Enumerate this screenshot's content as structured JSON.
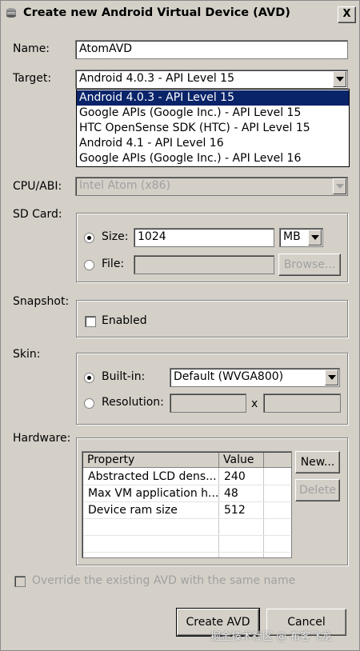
{
  "window": {
    "title": "Create new Android Virtual Device (AVD)",
    "close_label": "X"
  },
  "form": {
    "name_label": "Name:",
    "name_value": "AtomAVD",
    "target_label": "Target:",
    "target_value": "Android 4.0.3 - API Level 15",
    "target_options": [
      "Android 4.0.3 - API Level 15",
      "Google APIs (Google Inc.) - API Level 15",
      "HTC OpenSense SDK (HTC) - API Level 15",
      "Android 4.1 - API Level 16",
      "Google APIs (Google Inc.) - API Level 16"
    ],
    "cpu_label": "CPU/ABI:",
    "cpu_value": "Intel Atom (x86)"
  },
  "sdcard": {
    "label": "SD Card:",
    "size_label": "Size:",
    "size_value": "1024",
    "unit_value": "MB",
    "file_label": "File:",
    "file_value": "",
    "browse_label": "Browse..."
  },
  "snapshot": {
    "label": "Snapshot:",
    "enabled_label": "Enabled"
  },
  "skin": {
    "label": "Skin:",
    "builtin_label": "Built-in:",
    "builtin_value": "Default (WVGA800)",
    "resolution_label": "Resolution:",
    "x_label": "x"
  },
  "hardware": {
    "label": "Hardware:",
    "columns": [
      "Property",
      "Value"
    ],
    "rows": [
      {
        "property": "Abstracted LCD dens...",
        "value": "240"
      },
      {
        "property": "Max VM application h...",
        "value": "48"
      },
      {
        "property": "Device ram size",
        "value": "512"
      }
    ],
    "new_label": "New...",
    "delete_label": "Delete"
  },
  "override_label": "Override the existing AVD with the same name",
  "buttons": {
    "create_label": "Create AVD",
    "cancel_label": "Cancel"
  },
  "watermark": "掘金技术社区 @ 布客飞龙"
}
